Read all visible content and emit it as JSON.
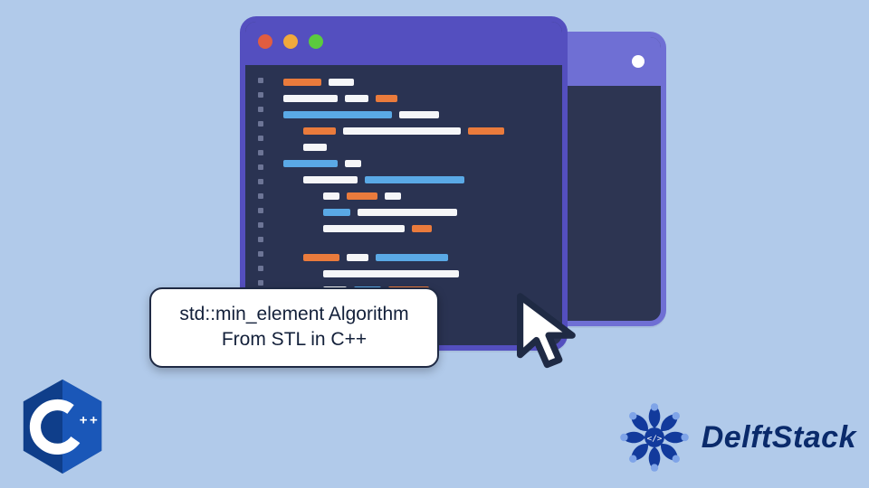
{
  "caption": {
    "line1": "std::min_element Algorithm",
    "line2": "From STL in C++"
  },
  "brand": {
    "name": "DelftStack"
  },
  "badge": {
    "language_label": "C++"
  },
  "colors": {
    "bg": "#b1caea",
    "window_border": "#544fbf",
    "window_bg": "#2a3352",
    "accent_orange": "#ea7b3c",
    "accent_blue": "#5aa9e6",
    "brand_blue": "#0a2a6b"
  },
  "icons": {
    "traffic_red": "red",
    "traffic_yellow": "yellow",
    "traffic_green": "green",
    "cursor": "pointer-cursor",
    "cpp_hex": "cpp-hexagon",
    "mandala": "mandala-ornament"
  }
}
